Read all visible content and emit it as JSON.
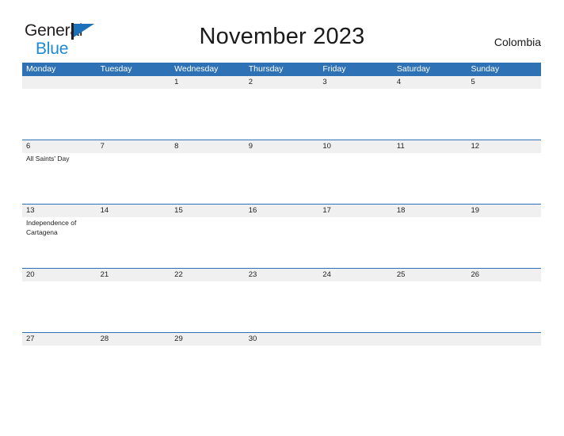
{
  "brand": {
    "name_part1": "General",
    "name_part2": "Blue",
    "flag_icon": "flag-icon",
    "colors": {
      "text_dark": "#231f20",
      "blue_dark": "#1c71b8",
      "blue_light": "#1c8ad6"
    }
  },
  "header": {
    "title": "November 2023",
    "country": "Colombia"
  },
  "theme": {
    "header_blue": "#2e72b5",
    "date_band_gray": "#f0f0f0",
    "cell_white": "#ffffff",
    "text": "#222222"
  },
  "calendar": {
    "month": "November",
    "year": "2023",
    "weekday_headers": [
      "Monday",
      "Tuesday",
      "Wednesday",
      "Thursday",
      "Friday",
      "Saturday",
      "Sunday"
    ],
    "weeks": [
      {
        "days": [
          {
            "date": "",
            "events": []
          },
          {
            "date": "",
            "events": []
          },
          {
            "date": "1",
            "events": []
          },
          {
            "date": "2",
            "events": []
          },
          {
            "date": "3",
            "events": []
          },
          {
            "date": "4",
            "events": []
          },
          {
            "date": "5",
            "events": []
          }
        ]
      },
      {
        "days": [
          {
            "date": "6",
            "events": [
              "All Saints' Day"
            ]
          },
          {
            "date": "7",
            "events": []
          },
          {
            "date": "8",
            "events": []
          },
          {
            "date": "9",
            "events": []
          },
          {
            "date": "10",
            "events": []
          },
          {
            "date": "11",
            "events": []
          },
          {
            "date": "12",
            "events": []
          }
        ]
      },
      {
        "days": [
          {
            "date": "13",
            "events": [
              "Independence of Cartagena"
            ]
          },
          {
            "date": "14",
            "events": []
          },
          {
            "date": "15",
            "events": []
          },
          {
            "date": "16",
            "events": []
          },
          {
            "date": "17",
            "events": []
          },
          {
            "date": "18",
            "events": []
          },
          {
            "date": "19",
            "events": []
          }
        ]
      },
      {
        "days": [
          {
            "date": "20",
            "events": []
          },
          {
            "date": "21",
            "events": []
          },
          {
            "date": "22",
            "events": []
          },
          {
            "date": "23",
            "events": []
          },
          {
            "date": "24",
            "events": []
          },
          {
            "date": "25",
            "events": []
          },
          {
            "date": "26",
            "events": []
          }
        ]
      },
      {
        "days": [
          {
            "date": "27",
            "events": []
          },
          {
            "date": "28",
            "events": []
          },
          {
            "date": "29",
            "events": []
          },
          {
            "date": "30",
            "events": []
          },
          {
            "date": "",
            "events": []
          },
          {
            "date": "",
            "events": []
          },
          {
            "date": "",
            "events": []
          }
        ]
      }
    ]
  }
}
